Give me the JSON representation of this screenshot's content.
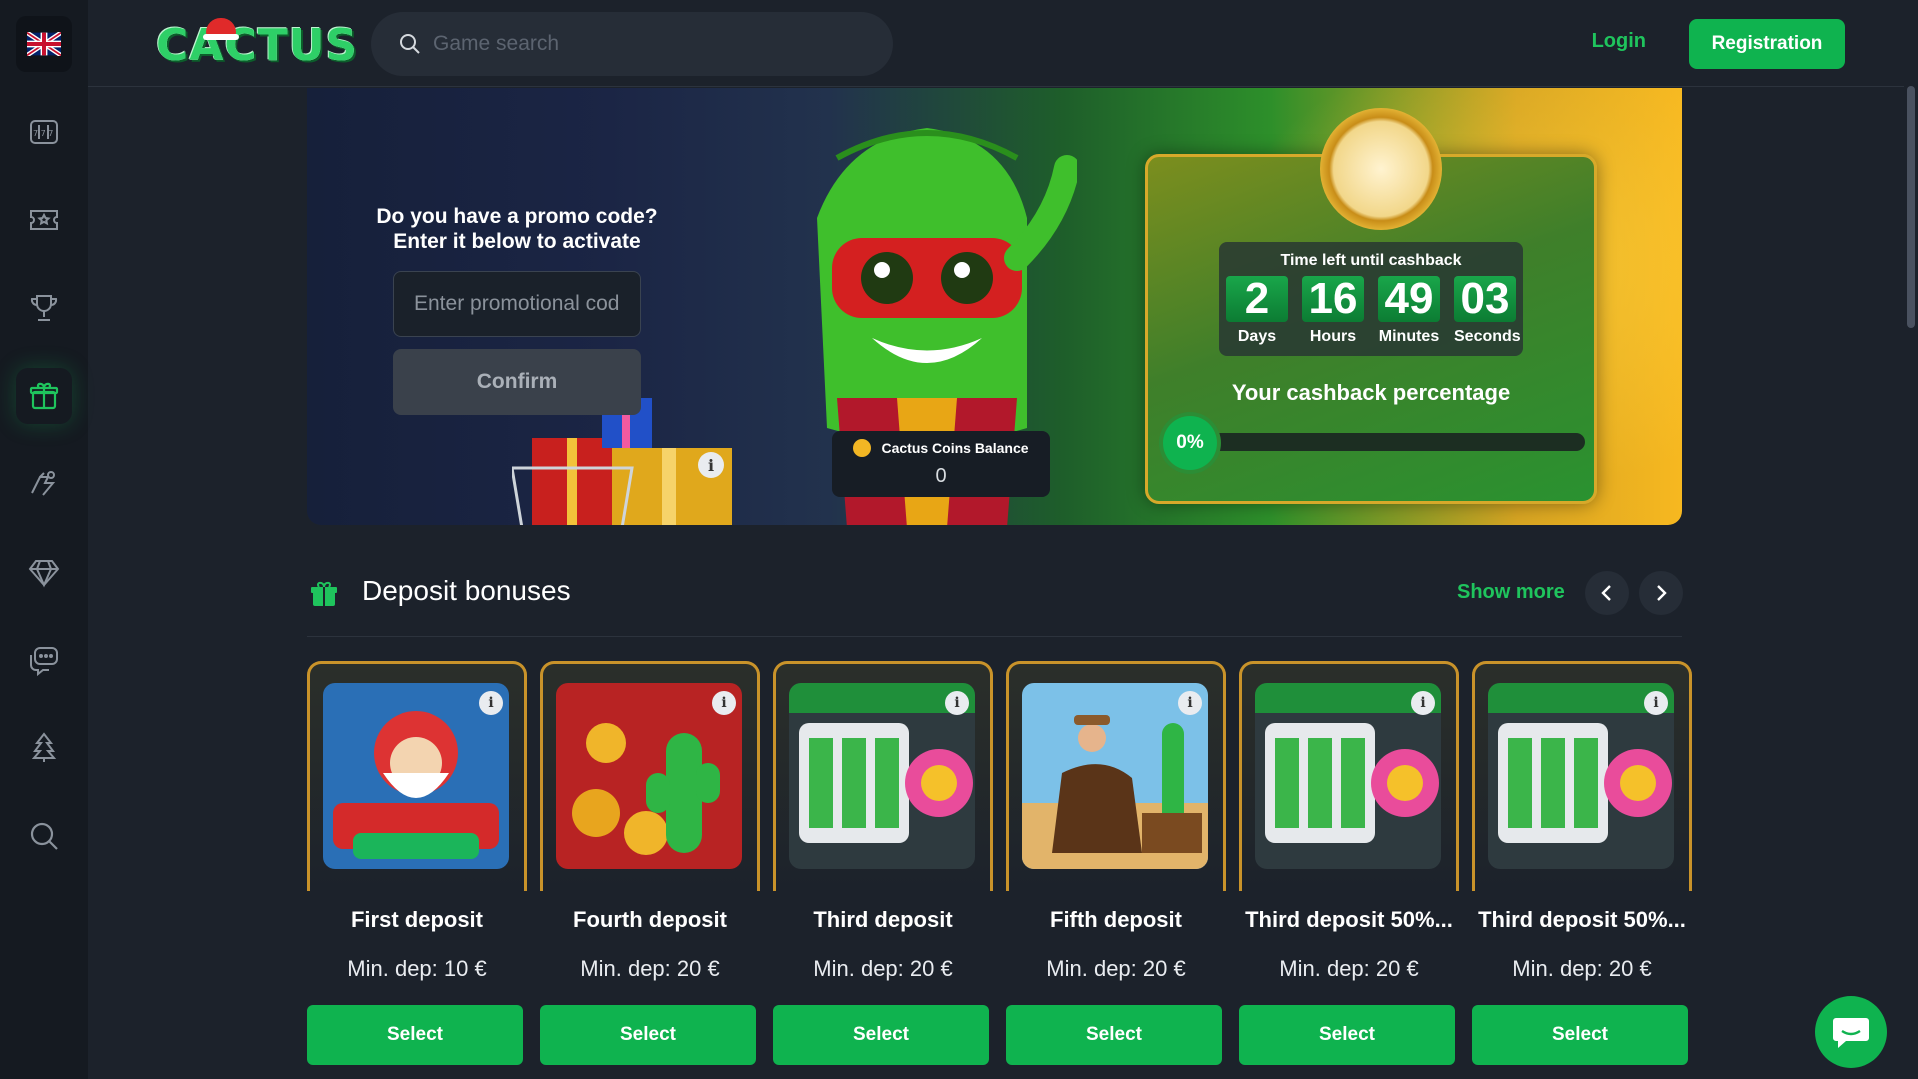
{
  "header": {
    "logo": "CACTUS",
    "search_placeholder": "Game search",
    "login": "Login",
    "register": "Registration"
  },
  "sidebar": {
    "items": [
      {
        "name": "language-flag-uk",
        "icon": "uk-flag-icon"
      },
      {
        "name": "slots",
        "icon": "slot-machine-icon"
      },
      {
        "name": "live-casino",
        "icon": "ticket-icon"
      },
      {
        "name": "tournaments",
        "icon": "trophy-icon"
      },
      {
        "name": "bonuses",
        "icon": "gift-icon",
        "active": true
      },
      {
        "name": "sports",
        "icon": "sport-icon"
      },
      {
        "name": "vip",
        "icon": "diamond-icon"
      },
      {
        "name": "support",
        "icon": "chat-icon"
      },
      {
        "name": "christmas",
        "icon": "tree-icon"
      },
      {
        "name": "search",
        "icon": "search-icon"
      }
    ]
  },
  "banner": {
    "promo_title_1": "Do you have a promo code?",
    "promo_title_2": "Enter it below to activate",
    "promo_placeholder": "Enter promotional code",
    "confirm": "Confirm",
    "coins_label": "Cactus Coins Balance",
    "coins_value": "0",
    "info": "i",
    "timer_title": "Time left until cashback",
    "timer": {
      "days": "2",
      "hours": "16",
      "minutes": "49",
      "seconds": "03",
      "days_label": "Days",
      "hours_label": "Hours",
      "minutes_label": "Minutes",
      "seconds_label": "Seconds"
    },
    "cashback_label": "Your cashback percentage",
    "cashback_percent": "0%",
    "cashback_progress": 0
  },
  "deposits": {
    "title": "Deposit bonuses",
    "show_more": "Show more",
    "cards": [
      {
        "name": "First deposit",
        "min_dep": "Min. dep: 10 €",
        "select": "Select"
      },
      {
        "name": "Fourth deposit",
        "min_dep": "Min. dep: 20 €",
        "select": "Select"
      },
      {
        "name": "Third deposit",
        "min_dep": "Min. dep: 20 €",
        "select": "Select"
      },
      {
        "name": "Fifth deposit",
        "min_dep": "Min. dep: 20 €",
        "select": "Select"
      },
      {
        "name": "Third deposit 50%...",
        "min_dep": "Min. dep: 20 €",
        "select": "Select"
      },
      {
        "name": "Third deposit 50%...",
        "min_dep": "Min. dep: 20 €",
        "select": "Select"
      }
    ]
  },
  "colors": {
    "accent": "#0fb34f",
    "link": "#1fc45d",
    "background": "#1c222b",
    "sidebar": "#151a21",
    "card_border": "#c9932a"
  }
}
